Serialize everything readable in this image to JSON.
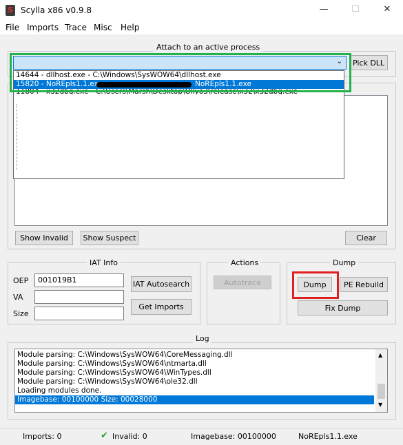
{
  "window": {
    "title": "Scylla x86 v0.9.8",
    "minimize_icon": "minimize-icon",
    "maximize_icon": "maximize-icon",
    "close_icon": "close-icon"
  },
  "menu": [
    "File",
    "Imports",
    "Trace",
    "Misc",
    "Help"
  ],
  "attach": {
    "group_label": "Attach to an active process",
    "pick_dll": "Pick DLL",
    "dropdown_items": [
      "14644 - dllhost.exe - C:\\Windows\\SysWOW64\\dllhost.exe",
      "15820 - NoREpls1.1.exe",
      "NoREpls1.1.exe",
      "11804 - x32dbg.exe - C:\\Users\\Marsh\\Desktop\\Ollyo3\\release\\x32\\x32dbg.exe"
    ]
  },
  "imports": {
    "show_invalid": "Show Invalid",
    "show_suspect": "Show Suspect",
    "clear": "Clear"
  },
  "iat": {
    "label": "IAT Info",
    "oep_label": "OEP",
    "oep_value": "001019B1",
    "va_label": "VA",
    "va_value": "",
    "size_label": "Size",
    "size_value": "",
    "autosearch": "IAT Autosearch",
    "get_imports": "Get Imports"
  },
  "actions": {
    "label": "Actions",
    "autotrace": "Autotrace"
  },
  "dump": {
    "label": "Dump",
    "dump_btn": "Dump",
    "pe_rebuild": "PE Rebuild",
    "fix_dump": "Fix Dump"
  },
  "log": {
    "label": "Log",
    "lines": [
      "Module parsing: C:\\Windows\\SysWOW64\\CoreMessaging.dll",
      "Module parsing: C:\\Windows\\SysWOW64\\ntmarta.dll",
      "Module parsing: C:\\Windows\\SysWOW64\\WinTypes.dll",
      "Module parsing: C:\\Windows\\SysWOW64\\ole32.dll",
      "Loading modules done.",
      "Imagebase: 00100000 Size: 00028000"
    ]
  },
  "status": {
    "imports": "Imports: 0",
    "invalid": "Invalid: 0",
    "imagebase": "Imagebase: 00100000",
    "module": "NoREpls1.1.exe"
  },
  "colors": {
    "highlight": "#0078d7",
    "green_box": "#22b14c",
    "red_box": "#e02020"
  }
}
